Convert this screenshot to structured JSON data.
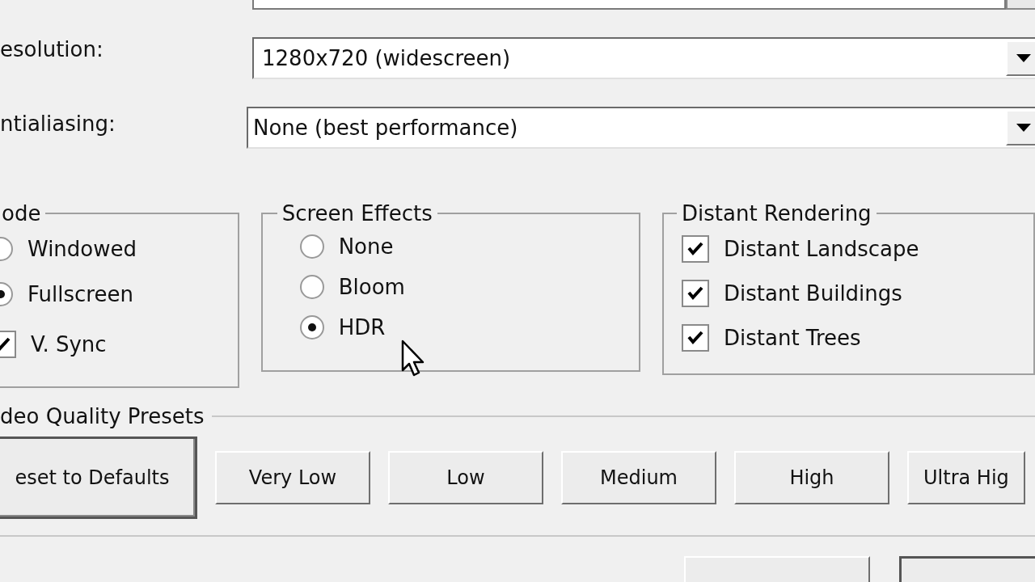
{
  "settings": [
    {
      "label": "esolution:",
      "value": "1280x720 (widescreen)"
    },
    {
      "label": "ntialiasing:",
      "value": "None (best performance)"
    }
  ],
  "groups": [
    {
      "title": "ode",
      "items": [
        {
          "kind": "radio",
          "label": "Windowed",
          "selected": false
        },
        {
          "kind": "radio",
          "label": "Fullscreen",
          "selected": true
        },
        {
          "kind": "checkbox",
          "label": "V. Sync",
          "checked": true
        }
      ]
    },
    {
      "title": "Screen Effects",
      "items": [
        {
          "kind": "radio",
          "label": "None",
          "selected": false
        },
        {
          "kind": "radio",
          "label": "Bloom",
          "selected": false
        },
        {
          "kind": "radio",
          "label": "HDR",
          "selected": true
        }
      ]
    },
    {
      "title": "Distant Rendering",
      "items": [
        {
          "kind": "checkbox",
          "label": "Distant Landscape",
          "checked": true
        },
        {
          "kind": "checkbox",
          "label": "Distant Buildings",
          "checked": true
        },
        {
          "kind": "checkbox",
          "label": "Distant Trees",
          "checked": true
        }
      ]
    }
  ],
  "presets": {
    "title": "deo Quality Presets",
    "buttons": [
      {
        "label": "eset to Defaults",
        "default": true
      },
      {
        "label": "Very Low",
        "default": false
      },
      {
        "label": "Low",
        "default": false
      },
      {
        "label": "Medium",
        "default": false
      },
      {
        "label": "High",
        "default": false
      },
      {
        "label": "Ultra Hig",
        "default": false
      }
    ]
  }
}
